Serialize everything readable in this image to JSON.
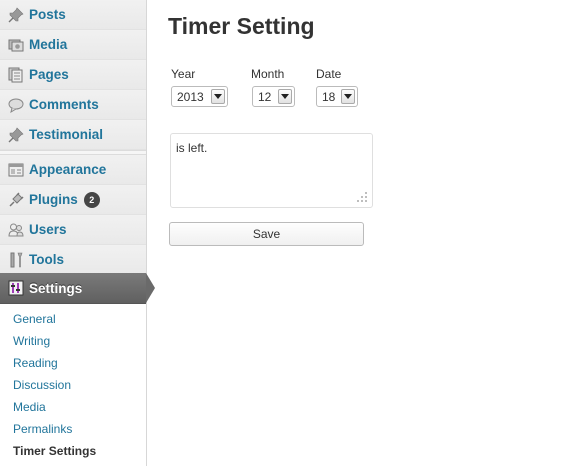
{
  "sidebar": {
    "items": [
      {
        "label": "Posts",
        "icon": "pushpin-icon"
      },
      {
        "label": "Media",
        "icon": "media-icon"
      },
      {
        "label": "Pages",
        "icon": "pages-icon"
      },
      {
        "label": "Comments",
        "icon": "comment-icon"
      },
      {
        "label": "Testimonial",
        "icon": "pushpin-icon"
      },
      {
        "label": "Appearance",
        "icon": "appearance-icon"
      },
      {
        "label": "Plugins",
        "icon": "plug-icon",
        "badge": "2"
      },
      {
        "label": "Users",
        "icon": "users-icon"
      },
      {
        "label": "Tools",
        "icon": "tools-icon"
      },
      {
        "label": "Settings",
        "icon": "settings-icon",
        "active": true
      }
    ],
    "submenu": [
      {
        "label": "General"
      },
      {
        "label": "Writing"
      },
      {
        "label": "Reading"
      },
      {
        "label": "Discussion"
      },
      {
        "label": "Media"
      },
      {
        "label": "Permalinks"
      },
      {
        "label": "Timer Settings",
        "current": true
      }
    ]
  },
  "main": {
    "title": "Timer Setting",
    "fields": {
      "year": {
        "label": "Year",
        "value": "2013"
      },
      "month": {
        "label": "Month",
        "value": "12"
      },
      "date": {
        "label": "Date",
        "value": "18"
      }
    },
    "message": "is left.",
    "save_label": "Save"
  },
  "colors": {
    "link": "#21759b",
    "active_menu": "#6a6a6a",
    "badge": "#464646"
  }
}
